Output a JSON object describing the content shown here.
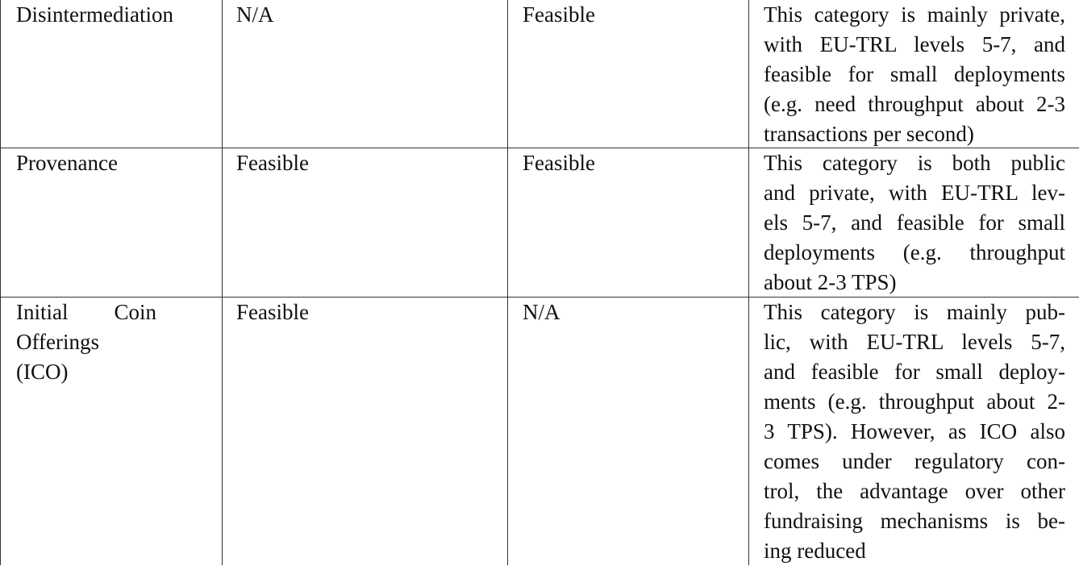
{
  "rows": [
    {
      "category": [
        "Disintermediation"
      ],
      "public": "N/A",
      "private": "Feasible",
      "remarks": [
        "This category is mainly private,",
        "with EU-TRL levels 5-7, and",
        "feasible for small deployments",
        "(e.g. need throughput about 2-3",
        "transactions per second)"
      ]
    },
    {
      "category": [
        "Provenance"
      ],
      "public": "Feasible",
      "private": "Feasible",
      "remarks": [
        "This category is both public",
        "and private, with EU-TRL lev-",
        "els 5-7, and feasible for small",
        "deployments (e.g. throughput",
        "about 2-3 TPS)"
      ]
    },
    {
      "category": [
        "Initial Coin",
        "Offerings",
        "(ICO)"
      ],
      "public": "Feasible",
      "private": "N/A",
      "remarks": [
        "This category is mainly pub-",
        "lic, with EU-TRL levels 5-7,",
        "and feasible for small deploy-",
        "ments (e.g. throughput about 2-",
        "3 TPS). However, as ICO also",
        "comes under regulatory con-",
        "trol, the advantage over other",
        "fundraising mechanisms is be-",
        "ing reduced"
      ]
    }
  ]
}
